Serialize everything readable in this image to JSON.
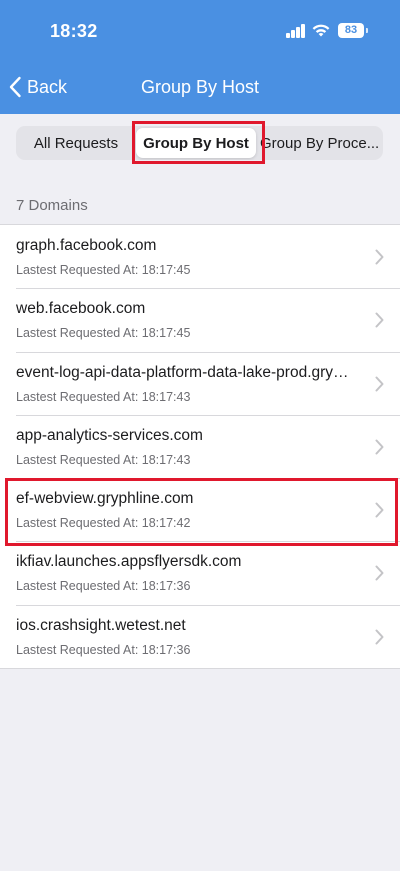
{
  "status_bar": {
    "time": "18:32",
    "battery": "83"
  },
  "nav": {
    "back_label": "Back",
    "title": "Group By Host"
  },
  "segments": [
    {
      "label": "All Requests",
      "selected": false
    },
    {
      "label": "Group By Host",
      "selected": true
    },
    {
      "label": "Group By Proce...",
      "selected": false
    }
  ],
  "section": {
    "header": "7 Domains"
  },
  "rows": [
    {
      "host": "graph.facebook.com",
      "sub": "Lastest Requested At: 18:17:45"
    },
    {
      "host": "web.facebook.com",
      "sub": "Lastest Requested At: 18:17:45"
    },
    {
      "host": "event-log-api-data-platform-data-lake-prod.gryphli...",
      "sub": "Lastest Requested At: 18:17:43"
    },
    {
      "host": "app-analytics-services.com",
      "sub": "Lastest Requested At: 18:17:43"
    },
    {
      "host": "ef-webview.gryphline.com",
      "sub": "Lastest Requested At: 18:17:42"
    },
    {
      "host": "ikfiav.launches.appsflyersdk.com",
      "sub": "Lastest Requested At: 18:17:36"
    },
    {
      "host": "ios.crashsight.wetest.net",
      "sub": "Lastest Requested At: 18:17:36"
    }
  ],
  "colors": {
    "header": "#4a90e2",
    "highlight": "#e0182d",
    "background": "#efeff4"
  },
  "icons": {
    "back": "chevron-left-icon",
    "row": "chevron-right-icon",
    "signal": "cellular-signal-icon",
    "wifi": "wifi-icon",
    "battery": "battery-icon"
  }
}
